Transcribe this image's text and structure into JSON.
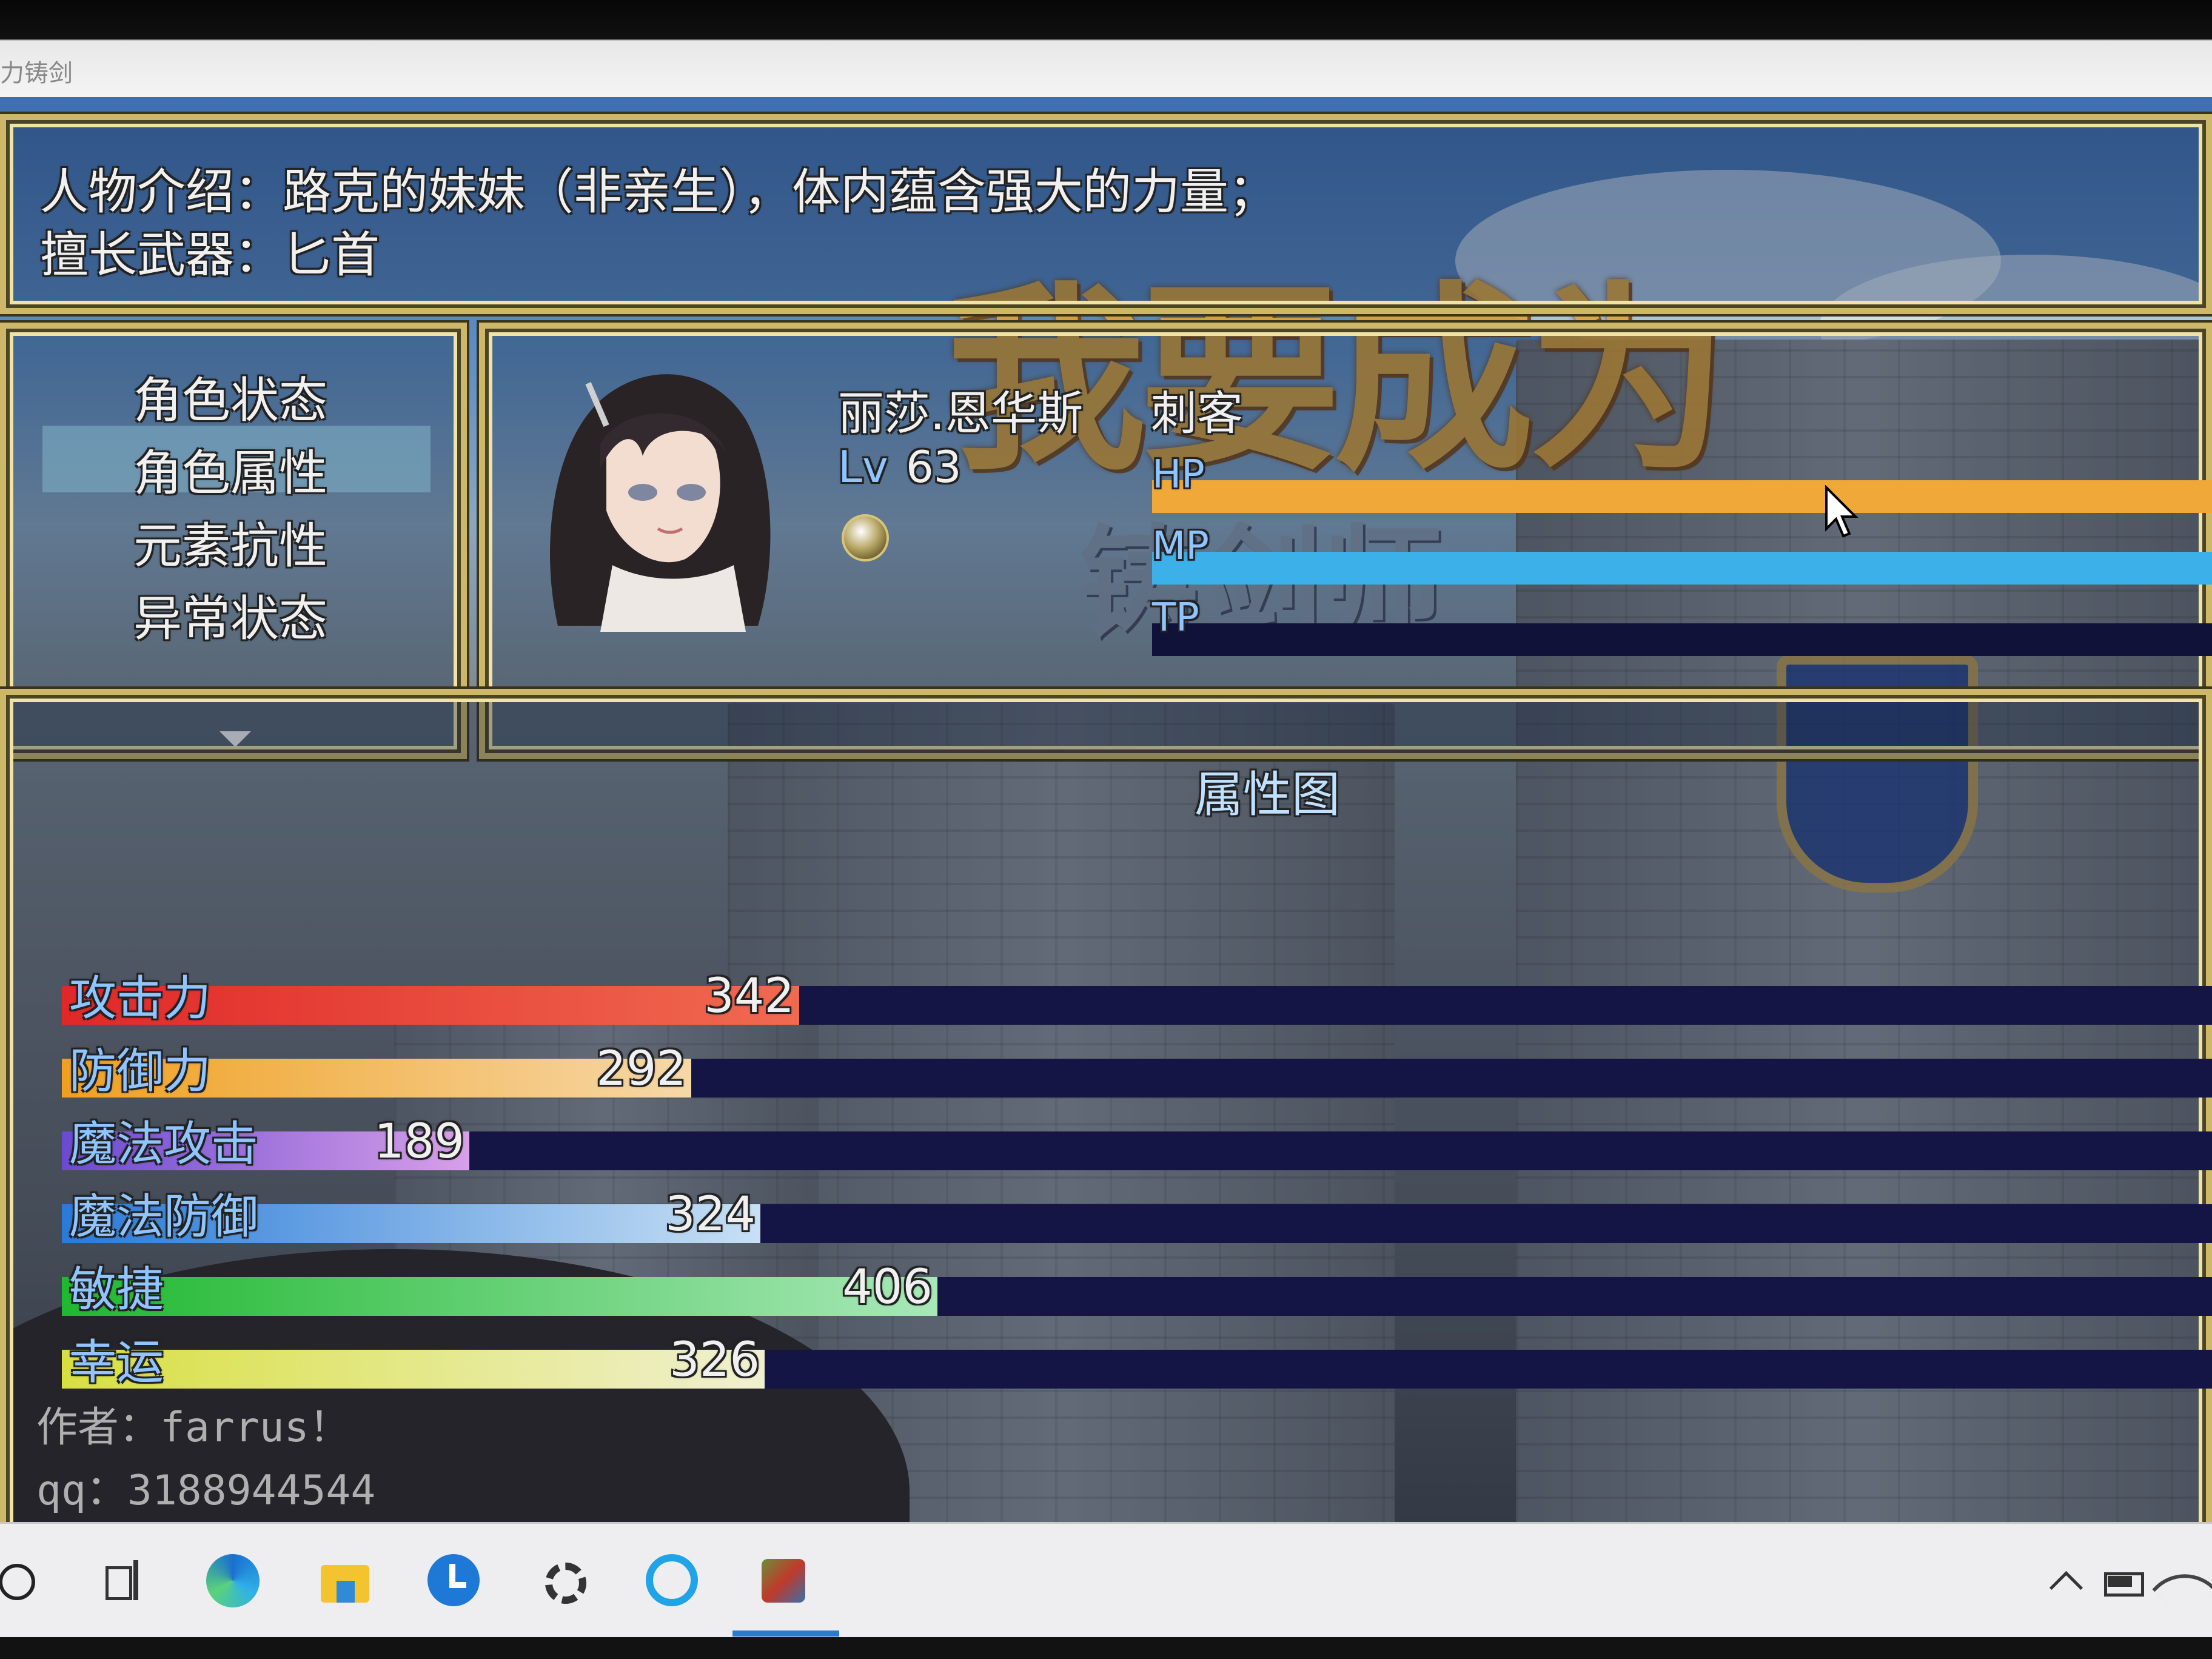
{
  "window": {
    "title": "力铸剑"
  },
  "info": {
    "line1": "人物介绍：路克的妹妹（非亲生），体内蕴含强大的力量；",
    "line2": "擅长武器：匕首"
  },
  "background": {
    "banner1": "我要成为",
    "banner2": "铸剑师"
  },
  "menu": {
    "items": [
      {
        "label": "角色状态",
        "selected": false
      },
      {
        "label": "角色属性",
        "selected": true
      },
      {
        "label": "元素抗性",
        "selected": false
      },
      {
        "label": "异常状态",
        "selected": false
      }
    ]
  },
  "character": {
    "name": "丽莎.恩华斯",
    "class": "刺客",
    "level_label": "Lv",
    "level": "63",
    "gauges": [
      {
        "label": "HP",
        "fill": 1.0,
        "color": "#f0a838"
      },
      {
        "label": "MP",
        "fill": 1.0,
        "color": "#3cb0e8"
      },
      {
        "label": "TP",
        "fill": 0.0,
        "color": "#e0c050"
      }
    ]
  },
  "stats": {
    "title": "属性图",
    "max": 1000,
    "items": [
      {
        "label": "攻击力",
        "value": 342,
        "from": "#e02828",
        "to": "#f06a50"
      },
      {
        "label": "防御力",
        "value": 292,
        "from": "#f0a020",
        "to": "#f6d8a8"
      },
      {
        "label": "魔法攻击",
        "value": 189,
        "from": "#6a4ad0",
        "to": "#d8a0e8"
      },
      {
        "label": "魔法防御",
        "value": 324,
        "from": "#2a7ad8",
        "to": "#c8e0f4"
      },
      {
        "label": "敏捷",
        "value": 406,
        "from": "#20b830",
        "to": "#a8e8b8"
      },
      {
        "label": "幸运",
        "value": 326,
        "from": "#d8e040",
        "to": "#f0f0d0"
      }
    ]
  },
  "credits": {
    "author": "作者：farrus！",
    "qq": "qq：3188944544"
  },
  "taskbar": {
    "icons": [
      "search-icon",
      "task-view-icon",
      "edge-icon",
      "file-explorer-icon",
      "clock-app-icon",
      "settings-gear-icon",
      "browser-icon",
      "game-app-icon",
      "chevron-up-icon",
      "battery-icon",
      "wifi-icon"
    ]
  }
}
